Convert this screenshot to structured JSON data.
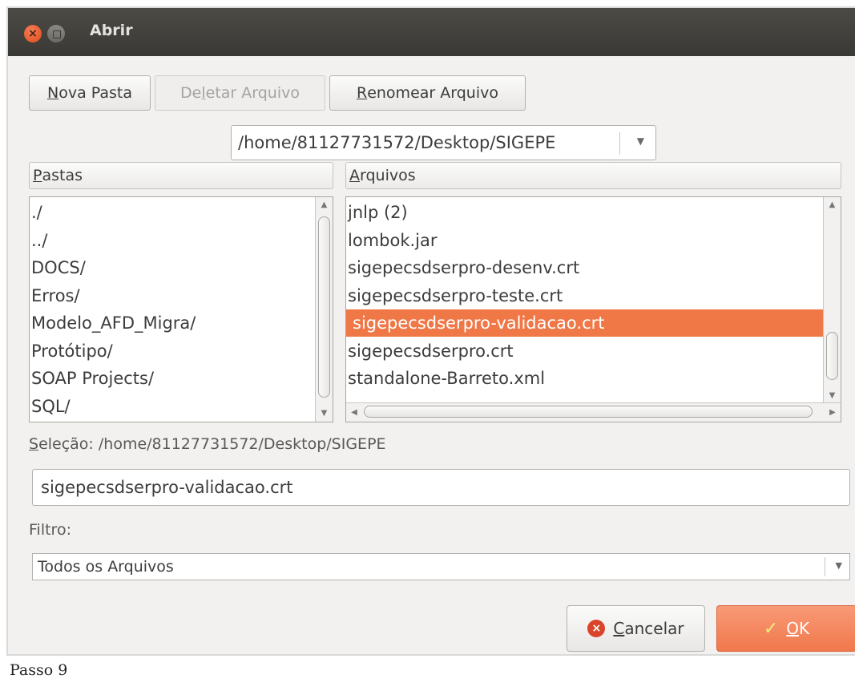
{
  "window": {
    "title": "Abrir"
  },
  "toolbar": {
    "new_folder": {
      "mnemonic": "N",
      "rest": "ova Pasta"
    },
    "delete_file": {
      "pre": "De",
      "mnemonic": "l",
      "rest": "etar Arquivo"
    },
    "rename_file": {
      "mnemonic": "R",
      "rest": "enomear Arquivo"
    }
  },
  "path_combo": {
    "value": "/home/81127731572/Desktop/SIGEPE"
  },
  "folders": {
    "header": {
      "mnemonic": "P",
      "rest": "astas"
    },
    "items": [
      "./",
      "../",
      "DOCS/",
      "Erros/",
      "Modelo_AFD_Migra/",
      "Protótipo/",
      "SOAP Projects/",
      "SQL/"
    ]
  },
  "files": {
    "header": {
      "mnemonic": "A",
      "rest": "rquivos"
    },
    "items": [
      "jnlp (2)",
      "lombok.jar",
      "sigepecsdserpro-desenv.crt",
      "sigepecsdserpro-teste.crt",
      "sigepecsdserpro-validacao.crt",
      "sigepecsdserpro.crt",
      "standalone-Barreto.xml"
    ],
    "selected_index": 4
  },
  "selection": {
    "label_mnemonic": "S",
    "label_rest": "eleção: /home/81127731572/Desktop/SIGEPE",
    "value": "sigepecsdserpro-validacao.crt"
  },
  "filter": {
    "label": "Filtro:",
    "value": "Todos os Arquivos"
  },
  "buttons": {
    "cancel": {
      "mnemonic": "C",
      "rest": "ancelar"
    },
    "ok": {
      "mnemonic": "O",
      "rest": "K"
    }
  },
  "caption": "Passo 9",
  "colors": {
    "selection": "#f07746",
    "ok_button": "#f1784c",
    "titlebar": "#3d3c38"
  },
  "icons": {
    "close": "close-icon",
    "minimize": "minimize-icon",
    "cancel": "cancel-icon",
    "ok": "checkmark-icon"
  }
}
